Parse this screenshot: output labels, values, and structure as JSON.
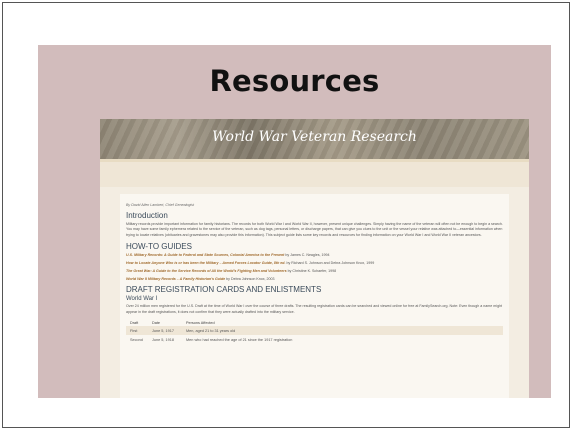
{
  "slide": {
    "title": "Resources"
  },
  "page": {
    "banner_title": "World War Veteran Research",
    "byline": "By David Allen Lambert, Chief Genealogist",
    "intro_heading": "Introduction",
    "intro_text": "Military records provide important information for family historians. The records for both World War I and World War II, however, present unique challenges. Simply having the name of the veteran will often not be enough to begin a search. You may have some family ephemera related to the service of the veteran, such as dog tags, personal letters, or discharge papers, that can give you clues to the unit or the vessel your relative was attached to—essential information when trying to locate relatives (obituaries and gravestones may also provide this information). This subject guide lists some key records and resources for finding information on your World War I and World War II veteran ancestors.",
    "howto_heading": "HOW-TO GUIDES",
    "guides": [
      {
        "title": "U.S. Military Records: A Guide to Federal and State Sources, Colonial America to the Present",
        "by": " by James C. Neagles, 1994"
      },
      {
        "title": "How to Locate Anyone Who is or has been the Military – Armed Forces Locator Guide, 8th ed.",
        "by": " by Richard S. Johnson and Debra Johnson Knox, 1999"
      },
      {
        "title": "The Great War: A Guide to the Service Records of All the World’s Fighting Men and Volunteers",
        "by": " by Christine K. Schaefer, 1998"
      },
      {
        "title": "World War II Military Records – A Family Historian’s Guide",
        "by": " by Debra Johnson Knox, 2003"
      }
    ],
    "draft_heading": "DRAFT REGISTRATION CARDS AND ENLISTMENTS",
    "ww1_heading": "World War I",
    "draft_text": "Over 24 million men registered for the U.S. Draft at the time of World War I over the course of three drafts. The resulting registration cards can be searched and viewed online for free at FamilySearch.org. Note: Even though a name might appear in the draft registrations, it does not confirm that they were actually drafted into the military service.",
    "table": {
      "headers": [
        "Draft",
        "Date",
        "Persons Affected"
      ],
      "rows": [
        [
          "First",
          "June 5, 1917",
          "Men, aged 21 to 31 years old"
        ],
        [
          "Second",
          "June 5, 1918",
          "Men who had reached the age of 21 since the 1917 registration"
        ]
      ]
    }
  }
}
